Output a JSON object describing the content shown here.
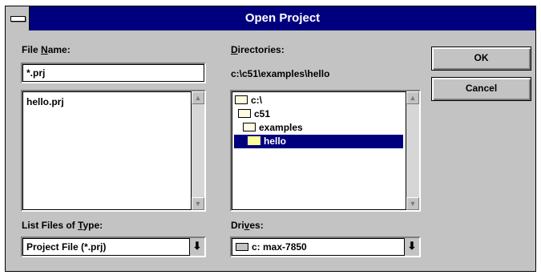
{
  "window": {
    "title": "Open Project"
  },
  "file_name": {
    "label_prefix": "File ",
    "label_mnemonic": "N",
    "label_suffix": "ame:",
    "value": "*.prj",
    "files": [
      "hello.prj"
    ]
  },
  "directories": {
    "label_mnemonic": "D",
    "label_suffix": "irectories:",
    "current_path": "c:\\c51\\examples\\hello",
    "tree": [
      {
        "label": "c:\\",
        "icon": "open-folder-icon"
      },
      {
        "label": "c51",
        "icon": "open-folder-icon"
      },
      {
        "label": "examples",
        "icon": "open-folder-icon"
      },
      {
        "label": "hello",
        "icon": "open-folder-icon",
        "selected": true
      }
    ]
  },
  "file_type": {
    "label_prefix": "List Files of ",
    "label_mnemonic": "T",
    "label_suffix": "ype:",
    "selected": "Project File (*.prj)"
  },
  "drives": {
    "label_prefix": "Dri",
    "label_mnemonic": "v",
    "label_suffix": "es:",
    "selected": "c: max-7850",
    "icon": "hard-drive-icon"
  },
  "buttons": {
    "ok": "OK",
    "cancel": "Cancel"
  },
  "scroll_arrows": {
    "up": "▲",
    "down": "▼",
    "combo": "⬇"
  }
}
